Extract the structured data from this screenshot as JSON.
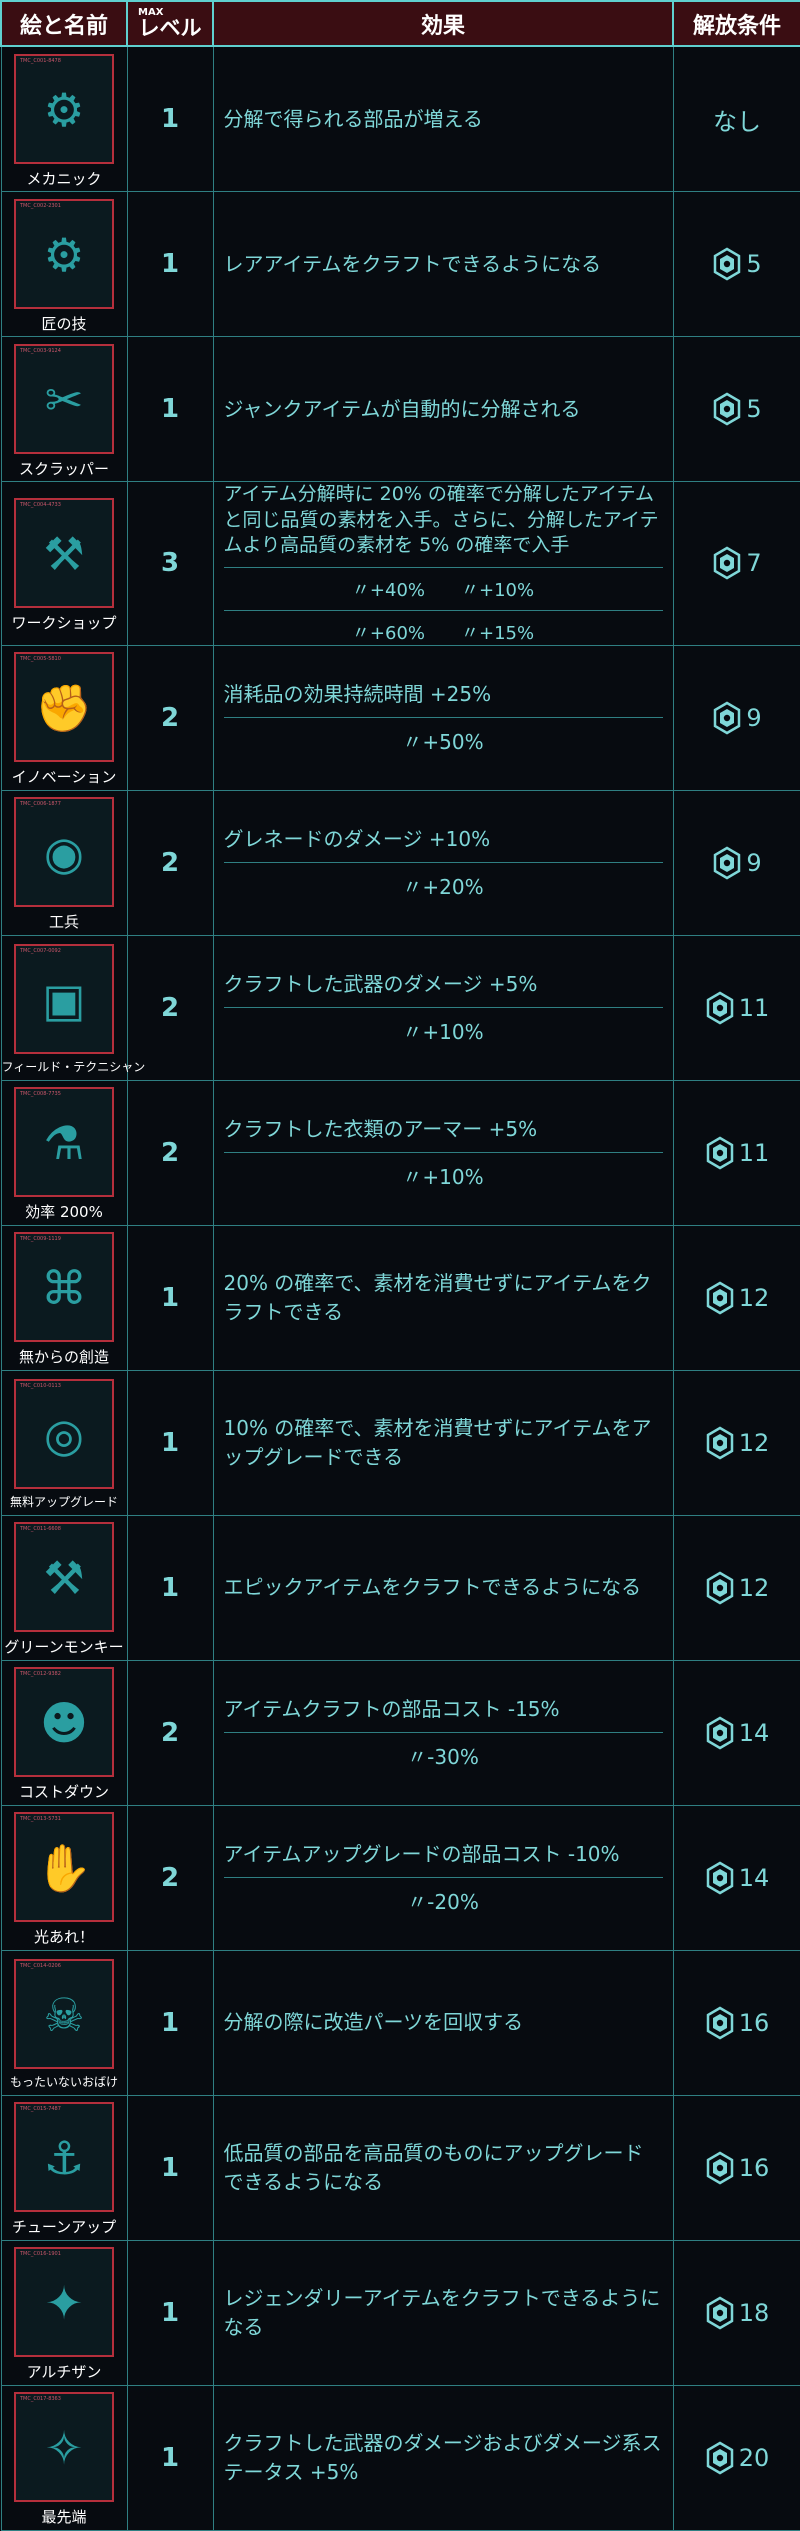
{
  "header": {
    "name": "絵と名前",
    "max": "MAX",
    "level": "レベル",
    "effect": "効果",
    "unlock": "解放条件"
  },
  "icons": {
    "unlock": "perk-points-gear-icon"
  },
  "colors": {
    "background": "#070b10",
    "accent": "#7fd7d8",
    "header_bg": "#3a0d12",
    "card_border": "#b52f3c"
  },
  "rows": [
    {
      "name": "メカニック",
      "icon": "pistol-parts-icon",
      "code": "TMC_C001-8478",
      "level": "1",
      "effect": "分解で得られる部品が増える",
      "sub": [],
      "unlock": "なし"
    },
    {
      "name": "匠の技",
      "icon": "gears-icon",
      "code": "TMC_C002-2301",
      "level": "1",
      "effect": "レアアイテムをクラフトできるようになる",
      "sub": [],
      "unlock": "5"
    },
    {
      "name": "スクラッパー",
      "icon": "cutter-hand-icon",
      "code": "TMC_C003-9124",
      "level": "1",
      "effect": "ジャンクアイテムが自動的に分解される",
      "sub": [],
      "unlock": "5"
    },
    {
      "name": "ワークショップ",
      "icon": "multitool-icon",
      "code": "TMC_C004-4733",
      "level": "3",
      "effect": "アイテム分解時に 20% の確率で分解したアイテムと同じ品質の素材を入手。さらに、分解したアイテムより高品質の素材を 5% の確率で入手",
      "sub": [
        "〃+40%　　〃+10%",
        "〃+60%　　〃+15%"
      ],
      "unlock": "7"
    },
    {
      "name": "イノベーション",
      "icon": "fist-icon",
      "code": "TMC_C005-5810",
      "level": "2",
      "effect": "消耗品の効果持続時間 +25%",
      "sub": [
        "〃+50%"
      ],
      "unlock": "9"
    },
    {
      "name": "工兵",
      "icon": "grenade-lips-icon",
      "code": "TMC_C006-1877",
      "level": "2",
      "effect": "グレネードのダメージ +10%",
      "sub": [
        "〃+20%"
      ],
      "unlock": "9"
    },
    {
      "name": "フィールド・テクニシャン",
      "icon": "circuit-gun-icon",
      "code": "TMC_C007-0092",
      "level": "2",
      "effect": "クラフトした武器のダメージ +5%",
      "sub": [
        "〃+10%"
      ],
      "unlock": "11"
    },
    {
      "name": "効率 200%",
      "icon": "bottle-icon",
      "code": "TMC_C008-7735",
      "level": "2",
      "effect": "クラフトした衣類のアーマー +5%",
      "sub": [
        "〃+10%"
      ],
      "unlock": "11"
    },
    {
      "name": "無からの創造",
      "icon": "bag-tag-icon",
      "code": "TMC_C009-1119",
      "level": "1",
      "effect": "20% の確率で、素材を消費せずにアイテムをクラフトできる",
      "sub": [],
      "unlock": "12"
    },
    {
      "name": "無料アップグレード",
      "icon": "tape-icon",
      "code": "TMC_C010-0113",
      "level": "1",
      "effect": "10% の確率で、素材を消費せずにアイテムをアップグレードできる",
      "sub": [],
      "unlock": "12"
    },
    {
      "name": "グリーンモンキー",
      "icon": "wrench-hand-icon",
      "code": "TMC_C011-6608",
      "level": "1",
      "effect": "エピックアイテムをクラフトできるようになる",
      "sub": [],
      "unlock": "12"
    },
    {
      "name": "コストダウン",
      "icon": "face-profile-icon",
      "code": "TMC_C012-9382",
      "level": "2",
      "effect": "アイテムクラフトの部品コスト -15%",
      "sub": [
        "〃-30%"
      ],
      "unlock": "14"
    },
    {
      "name": "光あれ！",
      "icon": "hand-light-icon",
      "code": "TMC_C013-5731",
      "level": "2",
      "effect": "アイテムアップグレードの部品コスト -10%",
      "sub": [
        "〃-20%"
      ],
      "unlock": "14"
    },
    {
      "name": "もったいないおばけ",
      "icon": "skull-icon",
      "code": "TMC_C014-0206",
      "level": "1",
      "effect": "分解の際に改造パーツを回収する",
      "sub": [],
      "unlock": "16"
    },
    {
      "name": "チューンアップ",
      "icon": "anvil-icon",
      "code": "TMC_C015-7487",
      "level": "1",
      "effect": "低品質の部品を高品質のものにアップグレードできるようになる",
      "sub": [],
      "unlock": "16"
    },
    {
      "name": "アルチザン",
      "icon": "origami-crane-icon",
      "code": "TMC_C016-1901",
      "level": "1",
      "effect": "レジェンダリーアイテムをクラフトできるようになる",
      "sub": [],
      "unlock": "18"
    },
    {
      "name": "最先端",
      "icon": "paper-crane-icon",
      "code": "TMC_C017-8363",
      "level": "1",
      "effect": "クラフトした武器のダメージおよびダメージ系ステータス +5%",
      "sub": [],
      "unlock": "20"
    }
  ]
}
